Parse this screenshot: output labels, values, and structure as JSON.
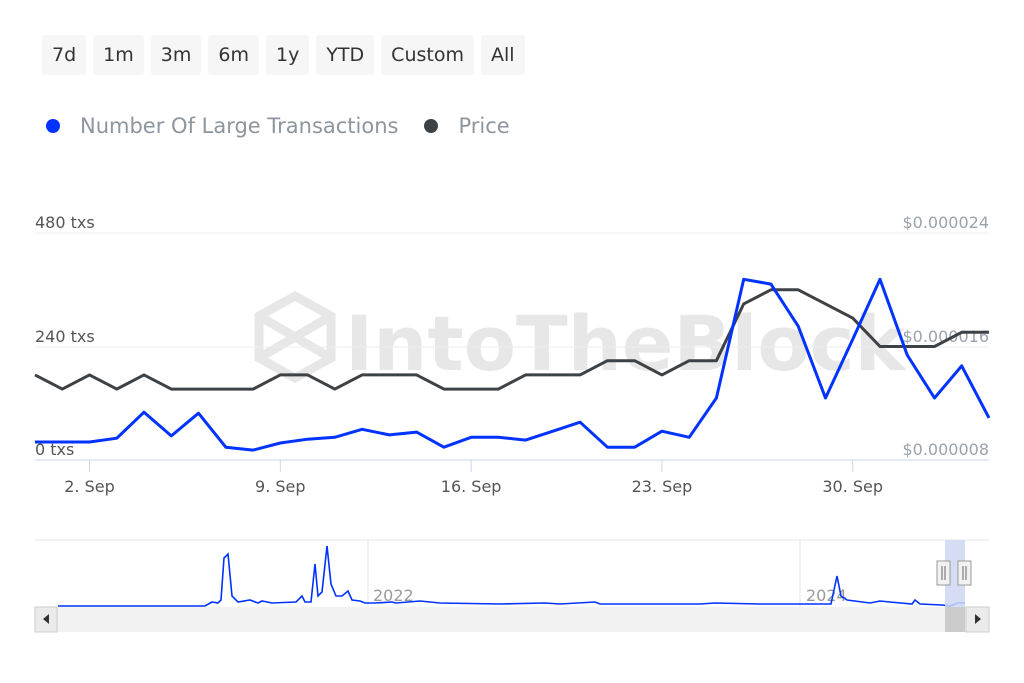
{
  "range_buttons": [
    "7d",
    "1m",
    "3m",
    "6m",
    "1y",
    "YTD",
    "Custom",
    "All"
  ],
  "legend": [
    {
      "label": "Number Of Large Transactions",
      "color": "#0033ff"
    },
    {
      "label": "Price",
      "color": "#3d4247"
    }
  ],
  "watermark": "IntoTheBlock",
  "chart_data": {
    "type": "line",
    "title": "",
    "x": [
      "31 Aug",
      "1 Sep",
      "2 Sep",
      "3 Sep",
      "4 Sep",
      "5 Sep",
      "6 Sep",
      "7 Sep",
      "8 Sep",
      "9 Sep",
      "10 Sep",
      "11 Sep",
      "12 Sep",
      "13 Sep",
      "14 Sep",
      "15 Sep",
      "16 Sep",
      "17 Sep",
      "18 Sep",
      "19 Sep",
      "20 Sep",
      "21 Sep",
      "22 Sep",
      "23 Sep",
      "24 Sep",
      "25 Sep",
      "26 Sep",
      "27 Sep",
      "28 Sep",
      "29 Sep",
      "30 Sep",
      "1 Oct",
      "2 Oct",
      "3 Oct",
      "4 Oct",
      "5 Oct"
    ],
    "x_tick_labels": [
      "2. Sep",
      "9. Sep",
      "16. Sep",
      "23. Sep",
      "30. Sep"
    ],
    "x_tick_indices": [
      2,
      9,
      16,
      23,
      30
    ],
    "y_left": {
      "label": "",
      "ticks": [
        "0 txs",
        "240 txs",
        "480 txs"
      ],
      "range": [
        0,
        480
      ]
    },
    "y_right": {
      "label": "",
      "ticks": [
        "$0.000008",
        "$0.000016",
        "$0.000024"
      ],
      "range": [
        8e-06,
        2.4e-05
      ]
    },
    "grid": true,
    "legend_position": "top-left",
    "series": [
      {
        "name": "Number Of Large Transactions",
        "axis": "left",
        "color": "#0033ff",
        "values": [
          38,
          38,
          38,
          46,
          101,
          51,
          99,
          27,
          21,
          36,
          44,
          48,
          65,
          53,
          59,
          27,
          48,
          48,
          42,
          61,
          80,
          27,
          27,
          61,
          48,
          131,
          382,
          372,
          283,
          131,
          255,
          382,
          222,
          131,
          199,
          89
        ]
      },
      {
        "name": "Price",
        "axis": "right",
        "color": "#3d4247",
        "values": [
          1.4e-05,
          1.3e-05,
          1.4e-05,
          1.3e-05,
          1.4e-05,
          1.3e-05,
          1.3e-05,
          1.3e-05,
          1.3e-05,
          1.4e-05,
          1.4e-05,
          1.3e-05,
          1.4e-05,
          1.4e-05,
          1.4e-05,
          1.3e-05,
          1.3e-05,
          1.3e-05,
          1.4e-05,
          1.4e-05,
          1.4e-05,
          1.5e-05,
          1.5e-05,
          1.4e-05,
          1.5e-05,
          1.5e-05,
          1.9e-05,
          2e-05,
          2e-05,
          1.9e-05,
          1.8e-05,
          1.6e-05,
          1.6e-05,
          1.6e-05,
          1.7e-05,
          1.7e-05
        ]
      }
    ]
  },
  "navigator": {
    "year_labels": [
      "2022",
      "2024"
    ],
    "series_color": "#0033ff",
    "selection_fraction": [
      0.975,
      1.0
    ]
  }
}
